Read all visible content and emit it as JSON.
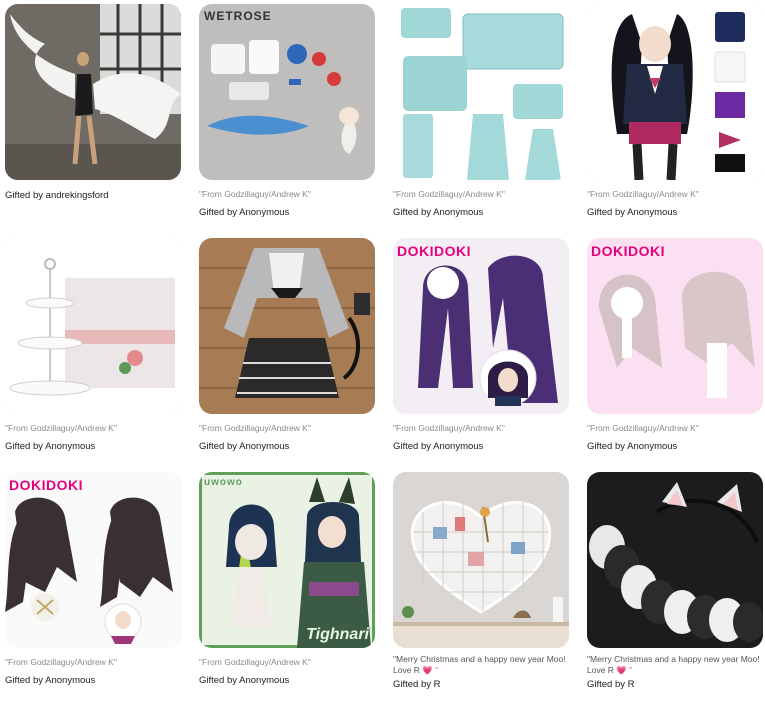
{
  "cards": [
    {
      "note": "",
      "gift": "Gifted by andrekingsford",
      "image": "angel-wings-photo"
    },
    {
      "note": "\"From Godzillaguy/Andrew K\"",
      "gift": "Gifted by Anonymous",
      "image": "sailor-costume-set",
      "brand": "WETROSE"
    },
    {
      "note": "\"From Godzillaguy/Andrew K\"",
      "gift": "Gifted by Anonymous",
      "image": "packing-cubes"
    },
    {
      "note": "\"From Godzillaguy/Andrew K\"",
      "gift": "Gifted by Anonymous",
      "image": "school-uniform-cosplay"
    },
    {
      "note": "\"From Godzillaguy/Andrew K\"",
      "gift": "Gifted by Anonymous",
      "image": "tiered-cake-stand"
    },
    {
      "note": "\"From Godzillaguy/Andrew K\"",
      "gift": "Gifted by Anonymous",
      "image": "gothic-lolita-dress"
    },
    {
      "note": "\"From Godzillaguy/Andrew K\"",
      "gift": "Gifted by Anonymous",
      "image": "purple-long-wig",
      "brand": "DOKIDOKI"
    },
    {
      "note": "\"From Godzillaguy/Andrew K\"",
      "gift": "Gifted by Anonymous",
      "image": "pink-short-wig",
      "brand": "DOKIDOKI"
    },
    {
      "note": "\"From Godzillaguy/Andrew K\"",
      "gift": "Gifted by Anonymous",
      "image": "dark-twin-tail-wig",
      "brand": "DOKIDOKI"
    },
    {
      "note": "\"From Godzillaguy/Andrew K\"",
      "gift": "Gifted by Anonymous",
      "image": "tighnari-wig",
      "brand": "uwowo",
      "caption": "Tighnari"
    },
    {
      "note": "\"Merry Christmas and a happy new year Moo!\nLove R",
      "gift": "Gifted by R",
      "image": "heart-grid-wall"
    },
    {
      "note": "\"Merry Christmas and a happy new year Moo!\nLove R",
      "gift": "Gifted by R",
      "image": "fur-ears-and-tail"
    }
  ],
  "heart_glyph": "💗 \"",
  "colors": {
    "brand_pink": "#e6007e",
    "muted": "#8a8a8a"
  }
}
